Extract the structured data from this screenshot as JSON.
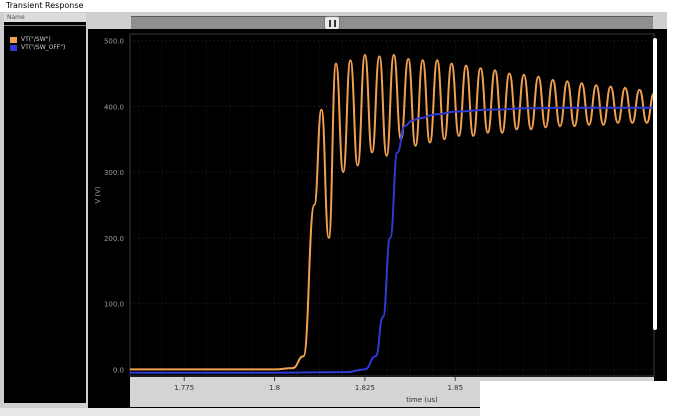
{
  "window": {
    "title": "Transient Response",
    "legend_header": "Name",
    "legend": [
      {
        "label": "VT(\"/SW\")",
        "color": "#f0a050",
        "icon": "orange-square-swatch"
      },
      {
        "label": "VT(\"/SW_OFF\")",
        "color": "#2f3bd6",
        "icon": "blue-square-swatch"
      }
    ]
  },
  "chart_data": {
    "type": "line",
    "title": "",
    "xlabel": "time (us)",
    "ylabel": "V (V)",
    "xlim": [
      1.76,
      1.905
    ],
    "ylim": [
      -10,
      510
    ],
    "yticks": [
      0.0,
      100.0,
      200.0,
      300.0,
      400.0,
      500.0
    ],
    "yticklabels": [
      "0.0",
      "100.0",
      "200.0",
      "300.0",
      "400.0",
      "500.0"
    ],
    "xticks": [
      1.775,
      1.8,
      1.825,
      1.85
    ],
    "xticklabels": [
      "1.775",
      "1.8",
      "1.825",
      "1.85"
    ],
    "x_unit_label": "(us)",
    "grid": true,
    "series": [
      {
        "name": "VT(\"/SW\")",
        "color": "#f0a050",
        "x": [
          1.76,
          1.77,
          1.78,
          1.79,
          1.8,
          1.805,
          1.808,
          1.811,
          1.813,
          1.815,
          1.817,
          1.819,
          1.821,
          1.823,
          1.825,
          1.827,
          1.829,
          1.831,
          1.833,
          1.835,
          1.837,
          1.839,
          1.841,
          1.843,
          1.845,
          1.847,
          1.849,
          1.851,
          1.853,
          1.855,
          1.857,
          1.859,
          1.861,
          1.863,
          1.865,
          1.867,
          1.869,
          1.871,
          1.873,
          1.875,
          1.877,
          1.879,
          1.881,
          1.883,
          1.885,
          1.887,
          1.889,
          1.891,
          1.893,
          1.895,
          1.897,
          1.899,
          1.901,
          1.903,
          1.905
        ],
        "y": [
          0,
          0,
          0,
          0,
          0,
          2,
          20,
          250,
          395,
          200,
          465,
          300,
          470,
          310,
          478,
          330,
          476,
          325,
          478,
          350,
          472,
          340,
          470,
          345,
          470,
          350,
          465,
          355,
          462,
          355,
          458,
          360,
          455,
          360,
          450,
          365,
          448,
          365,
          445,
          368,
          440,
          370,
          438,
          370,
          435,
          372,
          432,
          372,
          430,
          375,
          428,
          375,
          425,
          375,
          420
        ]
      },
      {
        "name": "VT(\"/SW_OFF\")",
        "color": "#2f3bd6",
        "x": [
          1.76,
          1.8,
          1.82,
          1.825,
          1.828,
          1.83,
          1.832,
          1.834,
          1.836,
          1.838,
          1.84,
          1.845,
          1.85,
          1.86,
          1.87,
          1.88,
          1.89,
          1.9,
          1.905
        ],
        "y": [
          -5,
          -5,
          -4,
          0,
          20,
          80,
          200,
          330,
          370,
          378,
          382,
          388,
          392,
          395,
          397,
          398,
          398,
          398,
          398
        ]
      }
    ]
  }
}
